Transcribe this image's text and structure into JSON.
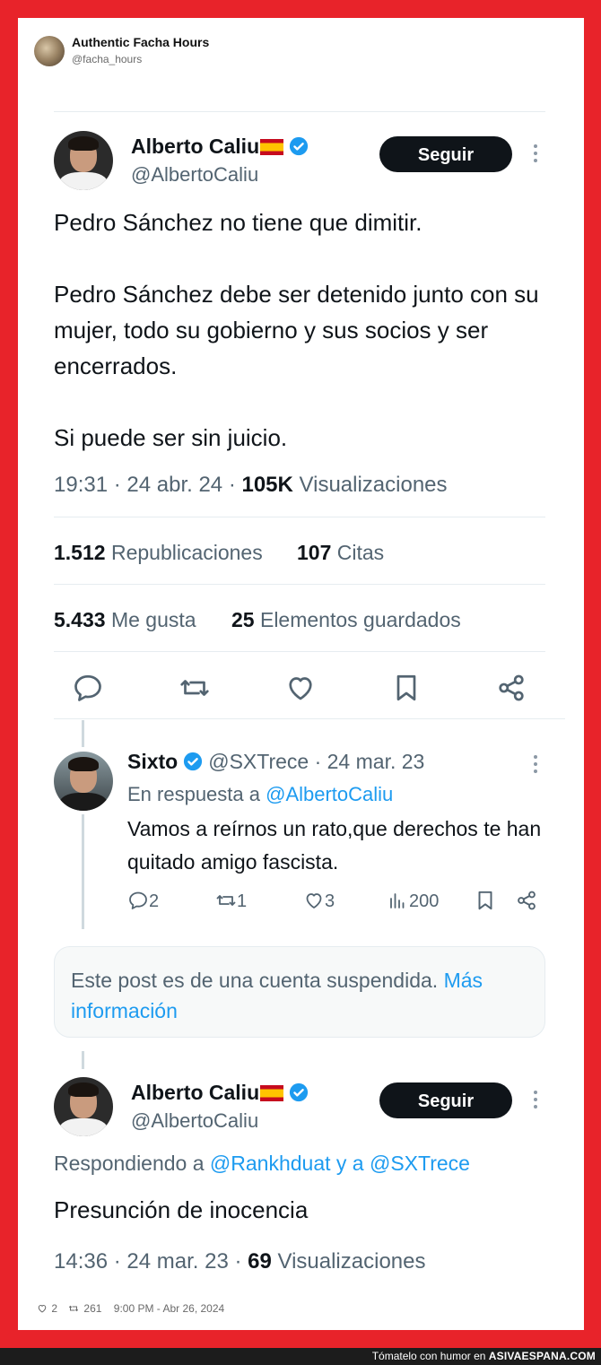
{
  "header": {
    "name": "Authentic Facha Hours",
    "handle": "@facha_hours"
  },
  "tweet1": {
    "name": "Alberto Caliu",
    "handle": "@AlbertoCaliu",
    "follow_label": "Seguir",
    "text": "Pedro Sánchez no tiene que dimitir.\n\nPedro Sánchez debe ser detenido junto con su mujer, todo su gobierno y sus socios y ser encerrados.\n\nSi puede ser sin juicio.",
    "time": "19:31 · 24 abr. 24 ·",
    "views_count": "105K",
    "views_label": "Visualizaciones",
    "reposts_count": "1.512",
    "reposts_label": "Republicaciones",
    "quotes_count": "107",
    "quotes_label": "Citas",
    "likes_count": "5.433",
    "likes_label": "Me gusta",
    "saves_count": "25",
    "saves_label": "Elementos guardados"
  },
  "reply": {
    "name": "Sixto",
    "handle": "@SXTrece · 24 mar. 23",
    "reply_prefix": "En respuesta a",
    "reply_to": "@AlbertoCaliu",
    "text": "Vamos a reírnos un rato,que derechos te han quitado amigo fascista.",
    "replies": "2",
    "retweets": "1",
    "likes": "3",
    "views": "200"
  },
  "suspended": {
    "text": "Este post es de una cuenta suspendida.",
    "link": "Más información"
  },
  "tweet2": {
    "name": "Alberto Caliu",
    "handle": "@AlbertoCaliu",
    "follow_label": "Seguir",
    "replying_prefix": "Respondiendo a",
    "replying_to": "@Rankhduat y a @SXTrece",
    "text": "Presunción de inocencia",
    "time": "14:36 · 24 mar. 23 ·",
    "views_count": "69",
    "views_label": "Visualizaciones"
  },
  "bottom": {
    "likes": "2",
    "retweets": "261",
    "timestamp": "9:00 PM - Abr 26, 2024"
  },
  "footer": {
    "prefix": "Tómatelo con humor en",
    "site": "ASIVAESPANA.COM"
  },
  "colors": {
    "frame": "#e8232a",
    "link": "#1d9bf0",
    "verified": "#1d9bf0",
    "button": "#0f1419"
  }
}
